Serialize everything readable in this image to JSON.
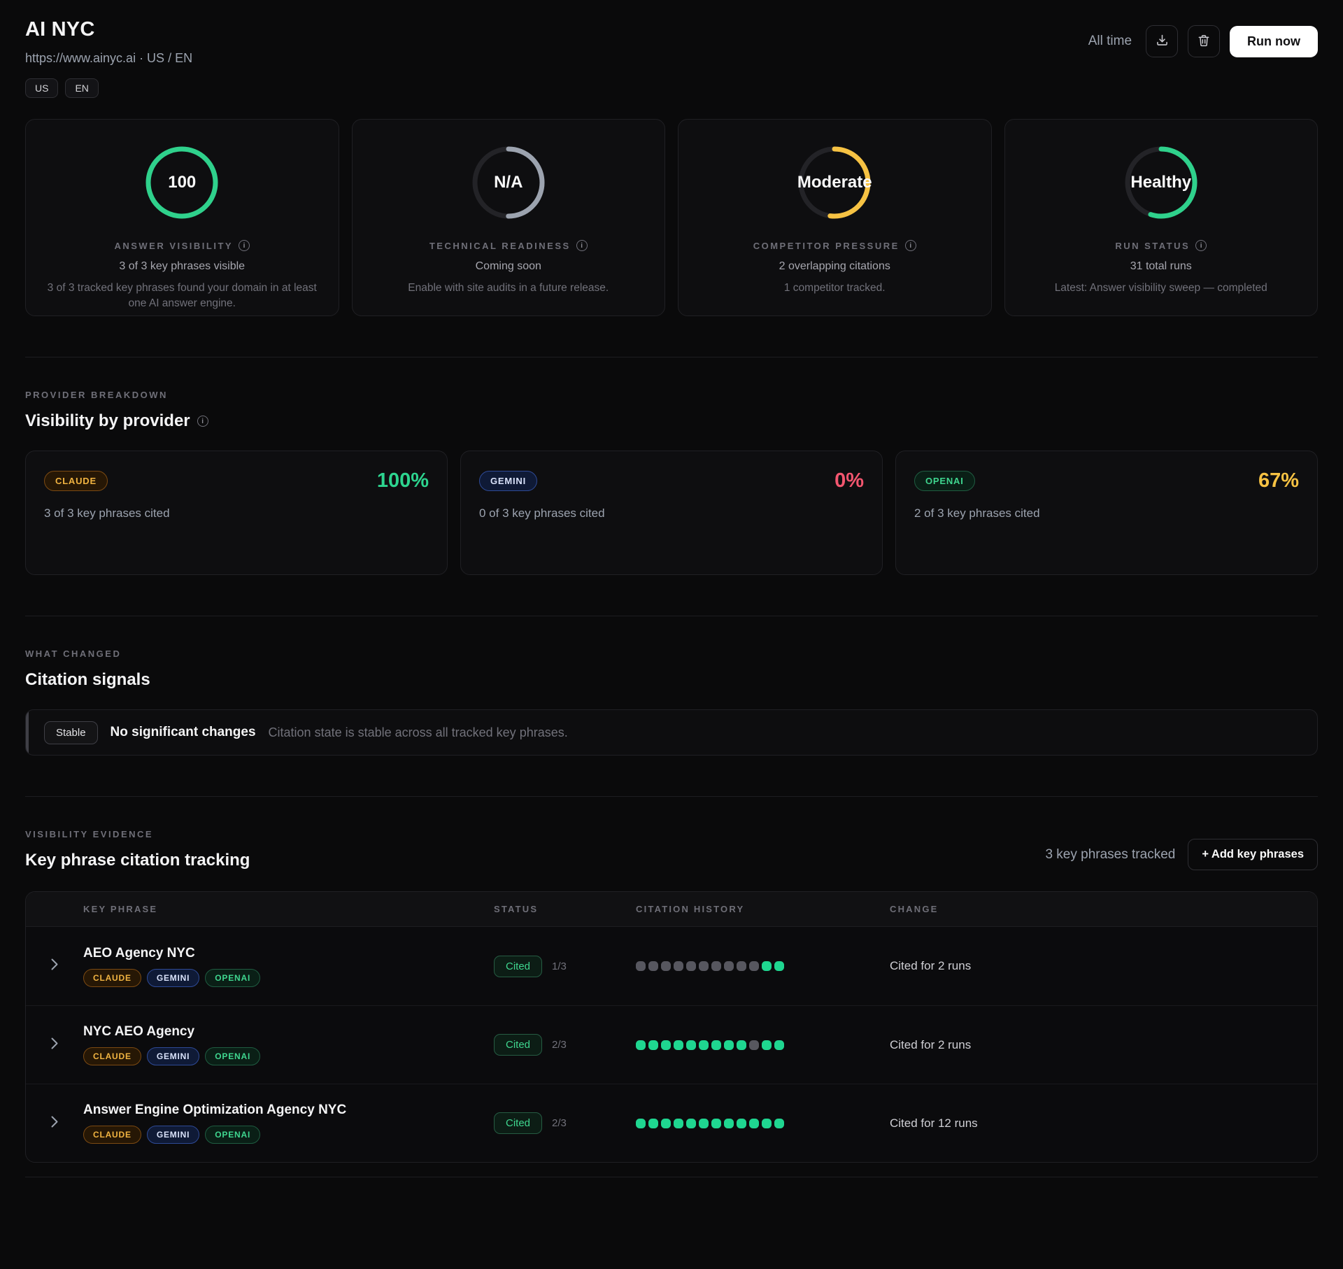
{
  "header": {
    "title": "AI NYC",
    "subtitle": "https://www.ainyc.ai · US / EN",
    "tags": [
      "US",
      "EN"
    ],
    "time_filter": "All time",
    "run_button": "Run now"
  },
  "icons": {
    "download": "download-tray-arrow",
    "trash": "trash-can",
    "info": "circled-i",
    "chevron": "chevron-right",
    "add": "plus"
  },
  "stat_cards": [
    {
      "value": "100",
      "label": "ANSWER VISIBILITY",
      "sub": "3 of 3 key phrases visible",
      "desc": "3 of 3 tracked key phrases found your domain in at least one AI answer engine.",
      "ring": {
        "pct": 100,
        "color": "#2fd18c",
        "track": "#232327"
      }
    },
    {
      "value": "N/A",
      "label": "TECHNICAL READINESS",
      "sub": "Coming soon",
      "desc": "Enable with site audits in a future release.",
      "ring": {
        "pct": 50,
        "color": "#9ca3af",
        "track": "#232327"
      }
    },
    {
      "value": "Moderate",
      "label": "COMPETITOR PRESSURE",
      "sub": "2 overlapping citations",
      "desc": "1 competitor tracked.",
      "ring": {
        "pct": 52,
        "color": "#f6c243",
        "track": "#232327"
      }
    },
    {
      "value": "Healthy",
      "label": "RUN STATUS",
      "sub": "31 total runs",
      "desc": "Latest: Answer visibility sweep — completed",
      "ring": {
        "pct": 55,
        "color": "#2fd18c",
        "track": "#232327"
      }
    }
  ],
  "provider_section": {
    "eyebrow": "PROVIDER BREAKDOWN",
    "title": "Visibility by provider",
    "providers": [
      {
        "name": "CLAUDE",
        "pct": "100%",
        "pct_color": "#2dd48f",
        "sub": "3 of 3 key phrases cited"
      },
      {
        "name": "GEMINI",
        "pct": "0%",
        "pct_color": "#f3566f",
        "sub": "0 of 3 key phrases cited"
      },
      {
        "name": "OPENAI",
        "pct": "67%",
        "pct_color": "#f6c243",
        "sub": "2 of 3 key phrases cited"
      }
    ]
  },
  "changes_section": {
    "eyebrow": "WHAT CHANGED",
    "title": "Citation signals",
    "badge": "Stable",
    "message": "No significant changes",
    "detail": "Citation state is stable across all tracked key phrases."
  },
  "tracking_section": {
    "eyebrow": "VISIBILITY EVIDENCE",
    "title": "Key phrase citation tracking",
    "count_label": "3 key phrases tracked",
    "add_button": "+ Add key phrases",
    "columns": [
      "KEY PHRASE",
      "STATUS",
      "CITATION HISTORY",
      "CHANGE"
    ],
    "rows": [
      {
        "phrase": "AEO Agency NYC",
        "providers": [
          "CLAUDE",
          "GEMINI",
          "OPENAI"
        ],
        "status": "Cited",
        "ratio": "1/3",
        "history": [
          0,
          0,
          0,
          0,
          0,
          0,
          0,
          0,
          0,
          0,
          1,
          1
        ],
        "change": "Cited for 2 runs"
      },
      {
        "phrase": "NYC AEO Agency",
        "providers": [
          "CLAUDE",
          "GEMINI",
          "OPENAI"
        ],
        "status": "Cited",
        "ratio": "2/3",
        "history": [
          1,
          1,
          1,
          1,
          1,
          1,
          1,
          1,
          1,
          0,
          1,
          1
        ],
        "change": "Cited for 2 runs"
      },
      {
        "phrase": "Answer Engine Optimization Agency NYC",
        "providers": [
          "CLAUDE",
          "GEMINI",
          "OPENAI"
        ],
        "status": "Cited",
        "ratio": "2/3",
        "history": [
          1,
          1,
          1,
          1,
          1,
          1,
          1,
          1,
          1,
          1,
          1,
          1
        ],
        "change": "Cited for 12 runs"
      }
    ]
  },
  "colors": {
    "green": "#2fd18c",
    "yellow": "#f6c243",
    "red": "#f3566f",
    "dot_on": "#1fd690",
    "dot_off": "#57575f",
    "background": "#0a0a0b"
  }
}
